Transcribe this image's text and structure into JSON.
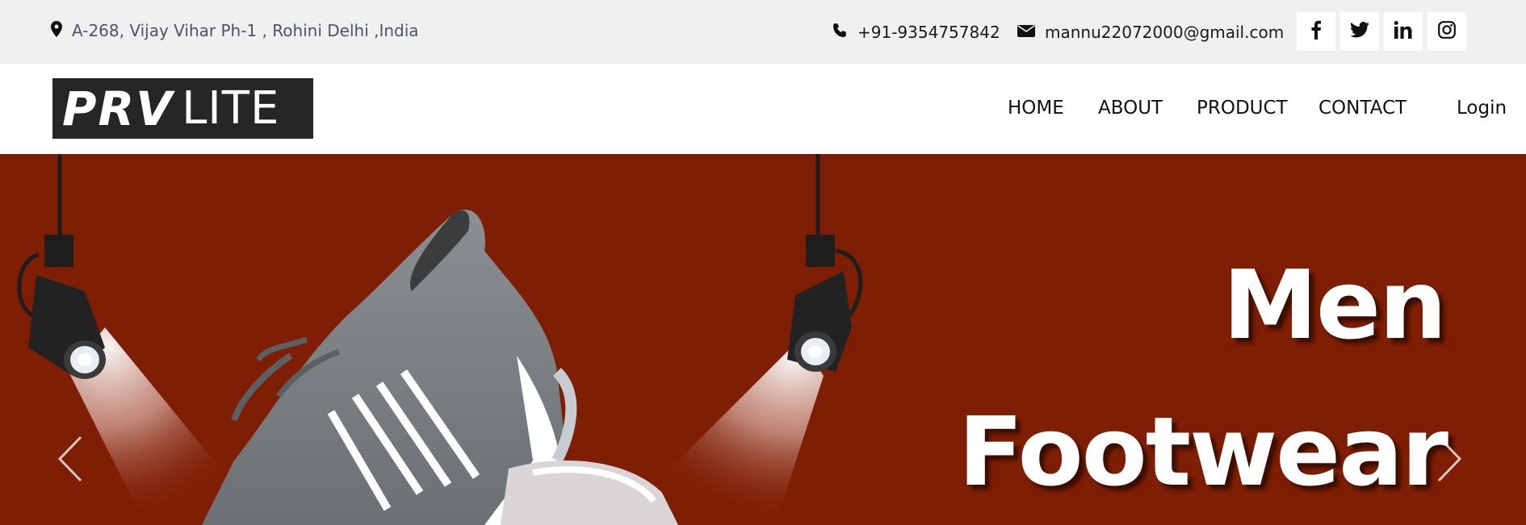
{
  "topbar": {
    "address": "A-268, Vijay Vihar Ph-1 , Rohini Delhi ,India",
    "phone": "+91-9354757842",
    "email": "mannu22072000@gmail.com",
    "social": [
      "facebook-icon",
      "twitter-icon",
      "linkedin-icon",
      "instagram-icon"
    ]
  },
  "logo": {
    "brand_bold": "PRV",
    "brand_light": "LITE"
  },
  "nav": {
    "items": [
      "HOME",
      "ABOUT",
      "PRODUCT",
      "CONTACT"
    ],
    "login": "Login"
  },
  "hero": {
    "title_line1": "Men",
    "title_line2": "Footwear",
    "background_color": "#7e1e04"
  },
  "colors": {
    "topbar_bg": "#f0f0f0",
    "logo_bg": "#262626",
    "text_dark": "#111111"
  }
}
